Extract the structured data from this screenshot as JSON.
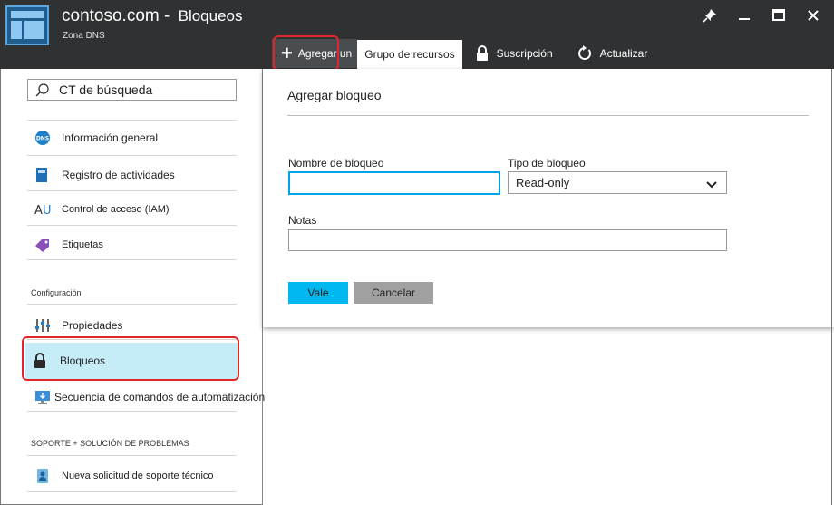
{
  "window": {
    "title": "contoso.com -",
    "section_title": "Bloqueos",
    "subtitle": "Zona DNS"
  },
  "toolbar": {
    "add_label": "Agregar un",
    "group_label": "Grupo de recursos",
    "subscription_label": "Suscripción",
    "refresh_label": "Actualizar"
  },
  "sidebar": {
    "search_placeholder": "CT de búsqueda",
    "items": [
      {
        "label": "Información general"
      },
      {
        "label": "Registro de actividades"
      },
      {
        "label": "Control de acceso (IAM)"
      },
      {
        "label": "Etiquetas"
      },
      {
        "label": "Propiedades"
      },
      {
        "label": "Bloqueos"
      },
      {
        "label": "Secuencia de comandos de automatización"
      },
      {
        "label": "Nueva solicitud de soporte técnico"
      }
    ],
    "sections": {
      "config": "Configuración",
      "support": "SOPORTE + SOLUCIÓN DE PROBLEMAS"
    }
  },
  "blade": {
    "title": "Agregar bloqueo",
    "lock_name_label": "Nombre de bloqueo",
    "lock_name_value": "",
    "lock_type_label": "Tipo de bloqueo",
    "lock_type_value": "Read-only",
    "notes_label": "Notas",
    "notes_value": "",
    "ok_label": "Vale",
    "cancel_label": "Cancelar"
  },
  "colors": {
    "header_bg": "#2f3133",
    "selected_bg": "#c6ecf8",
    "accent": "#00b7f0",
    "highlight": "#e0262b"
  }
}
